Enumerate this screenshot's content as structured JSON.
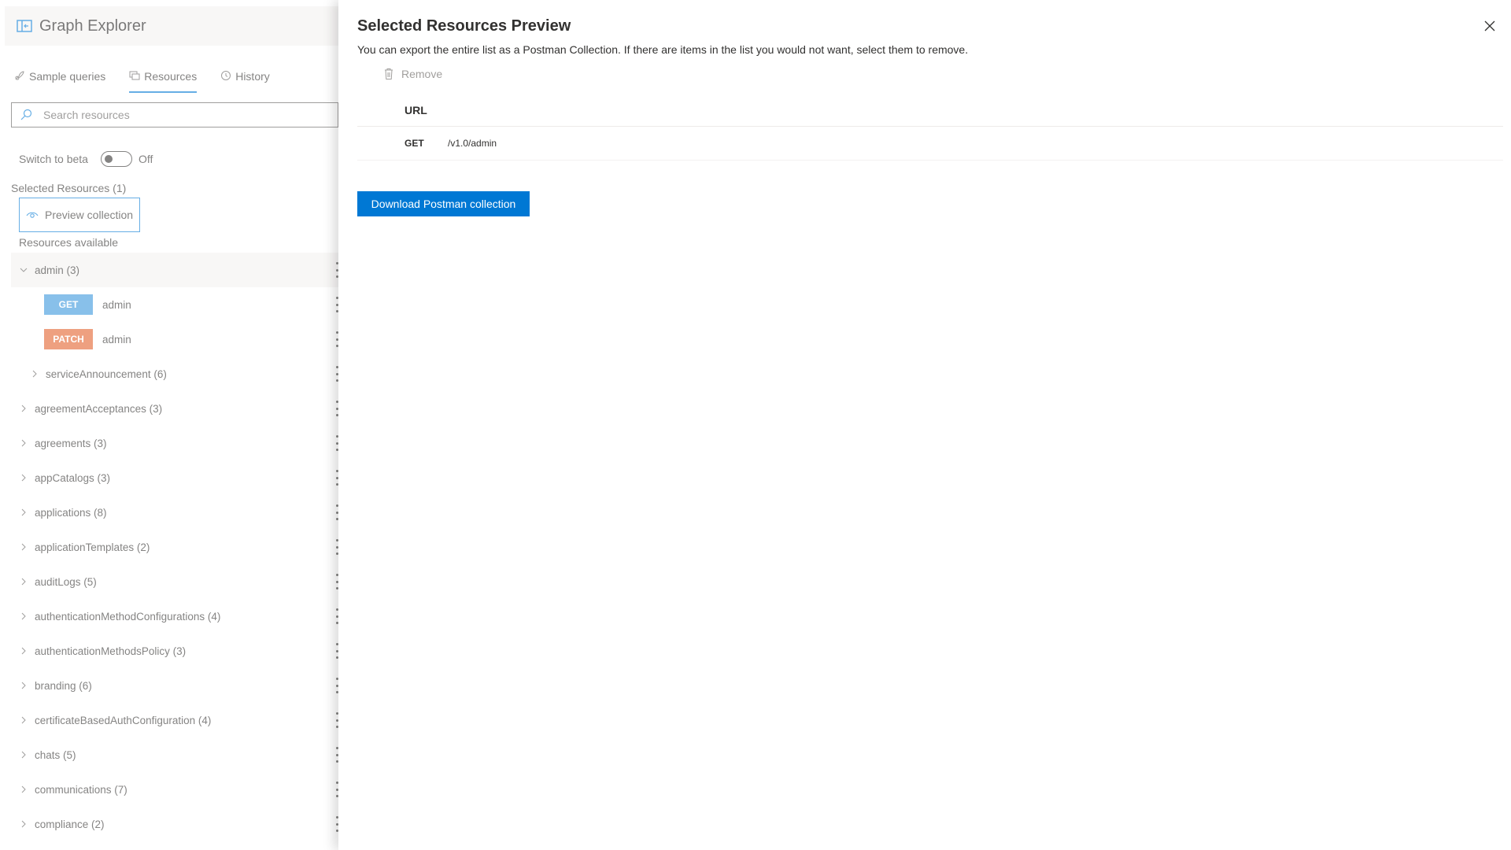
{
  "app": {
    "title": "Graph Explorer"
  },
  "tabs": [
    {
      "label": "Sample queries",
      "icon": "rocket-icon"
    },
    {
      "label": "Resources",
      "icon": "resources-icon",
      "active": true
    },
    {
      "label": "History",
      "icon": "history-icon"
    }
  ],
  "search": {
    "placeholder": "Search resources"
  },
  "beta": {
    "label": "Switch to beta",
    "state_label": "Off",
    "enabled": false
  },
  "selected": {
    "label": "Selected Resources (1)",
    "preview_label": "Preview collection"
  },
  "available": {
    "label": "Resources available"
  },
  "tree": {
    "admin": "admin (3)",
    "get_method": "GET",
    "get_label": "admin",
    "patch_method": "PATCH",
    "patch_label": "admin",
    "service": "serviceAnnouncement (6)",
    "items": [
      "agreementAcceptances (3)",
      "agreements (3)",
      "appCatalogs (3)",
      "applications (8)",
      "applicationTemplates (2)",
      "auditLogs (5)",
      "authenticationMethodConfigurations (4)",
      "authenticationMethodsPolicy (3)",
      "branding (6)",
      "certificateBasedAuthConfiguration (4)",
      "chats (5)",
      "communications (7)",
      "compliance (2)"
    ]
  },
  "panel": {
    "title": "Selected Resources Preview",
    "description": "You can export the entire list as a Postman Collection. If there are items in the list you would not want, select them to remove.",
    "remove_label": "Remove",
    "column_url": "URL",
    "rows": [
      {
        "method": "GET",
        "url": "/v1.0/admin"
      }
    ],
    "download_label": "Download Postman collection"
  },
  "colors": {
    "accent": "#0078d4",
    "get": "#3a96dd",
    "patch": "#e3612c"
  }
}
